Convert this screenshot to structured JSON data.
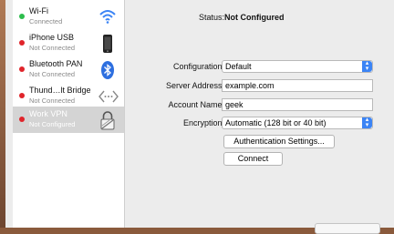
{
  "services": [
    {
      "name": "Wi-Fi",
      "status": "Connected",
      "dot": "#2dbd4c",
      "icon": "wifi-icon"
    },
    {
      "name": "iPhone USB",
      "status": "Not Connected",
      "dot": "#e0242a",
      "icon": "iphone-icon"
    },
    {
      "name": "Bluetooth PAN",
      "status": "Not Connected",
      "dot": "#e0242a",
      "icon": "bluetooth-icon"
    },
    {
      "name": "Thund…lt Bridge",
      "status": "Not Connected",
      "dot": "#e0242a",
      "icon": "thunderbolt-bridge-icon"
    },
    {
      "name": "Work VPN",
      "status": "Not Configured",
      "dot": "#e0242a",
      "icon": "vpn-lock-icon"
    }
  ],
  "detail": {
    "status_label": "Status:",
    "status_value": "Not Configured",
    "configuration_label": "Configuration:",
    "configuration_value": "Default",
    "server_label": "Server Address:",
    "server_value": "example.com",
    "account_label": "Account Name:",
    "account_value": "geek",
    "encryption_label": "Encryption:",
    "encryption_value": "Automatic (128 bit or 40 bit)",
    "auth_button": "Authentication Settings...",
    "connect_button": "Connect"
  },
  "colors": {
    "accent": "#3b84f5",
    "selected_row": "#d4d4d4"
  }
}
